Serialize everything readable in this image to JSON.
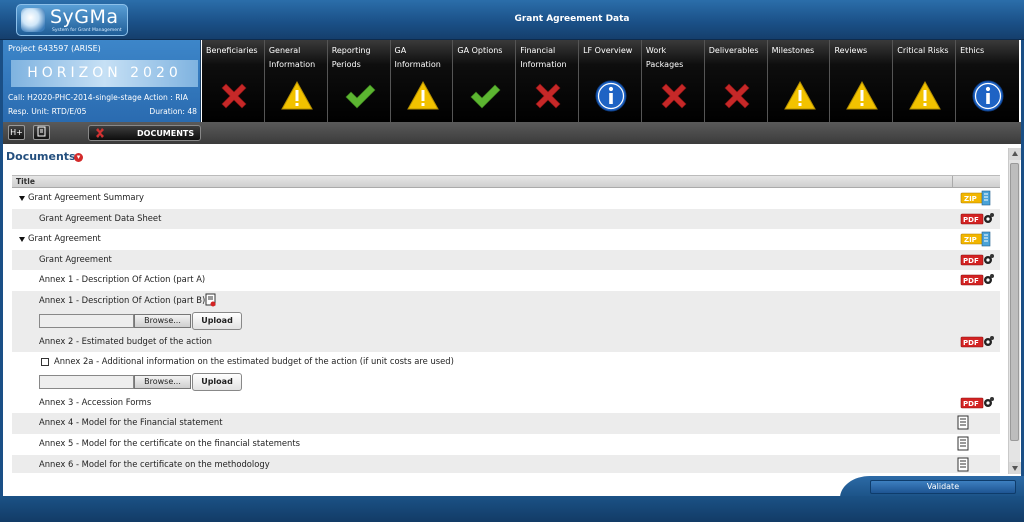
{
  "header": {
    "logo_text": "SyGMa",
    "logo_sub": "System for Grant Management",
    "title": "Grant Agreement Data"
  },
  "project": {
    "id": "Project 643597 (ARISE)",
    "programme": "HORIZON 2020",
    "call": "Call: H2020-PHC-2014-single-stage",
    "action": "Action : RIA",
    "unit": "Resp. Unit: RTD/E/05",
    "duration": "Duration: 48"
  },
  "tabs": [
    {
      "label": "Beneficiaries",
      "status": "error"
    },
    {
      "label": "General Information",
      "status": "warning"
    },
    {
      "label": "Reporting Periods",
      "status": "ok"
    },
    {
      "label": "GA Information",
      "status": "warning"
    },
    {
      "label": "GA Options",
      "status": "ok"
    },
    {
      "label": "Financial Information",
      "status": "error"
    },
    {
      "label": "LF Overview",
      "status": "info"
    },
    {
      "label": "Work Packages",
      "status": "error"
    },
    {
      "label": "Deliverables",
      "status": "error"
    },
    {
      "label": "Milestones",
      "status": "warning"
    },
    {
      "label": "Reviews",
      "status": "warning"
    },
    {
      "label": "Critical Risks",
      "status": "warning"
    },
    {
      "label": "Ethics",
      "status": "info"
    }
  ],
  "toolbar": {
    "btn1": "H+",
    "documents_label": "DOCUMENTS"
  },
  "documents": {
    "title": "Documents",
    "column_title": "Title",
    "rows": [
      {
        "text": "Grant Agreement Summary",
        "type": "group",
        "icon": "zip"
      },
      {
        "text": "Grant Agreement Data Sheet",
        "type": "child",
        "icon": "pdf"
      },
      {
        "text": "Grant Agreement",
        "type": "group",
        "icon": "zip"
      },
      {
        "text": "Grant Agreement",
        "type": "child",
        "icon": "pdf"
      },
      {
        "text": "Annex 1 - Description Of Action (part A)",
        "type": "child",
        "icon": "pdf"
      },
      {
        "text": "Annex 1 - Description Of Action (part B)",
        "type": "child",
        "icon": "none"
      },
      {
        "text": "Annex 2 - Estimated budget of the action",
        "type": "child",
        "icon": "pdf"
      },
      {
        "text": "Annex 2a - Additional information on the estimated budget of the action (if unit costs are used)",
        "type": "child",
        "icon": "none"
      },
      {
        "text": "Annex 3 - Accession Forms",
        "type": "child",
        "icon": "pdf"
      },
      {
        "text": "Annex 4 - Model for the Financial statement",
        "type": "child",
        "icon": "doc"
      },
      {
        "text": "Annex 5 - Model for the certificate on the financial statements",
        "type": "child",
        "icon": "doc"
      },
      {
        "text": "Annex 6 - Model for the certificate on the methodology",
        "type": "child",
        "icon": "doc"
      }
    ],
    "browse_label": "Browse...",
    "upload_label": "Upload"
  },
  "footer": {
    "validate_label": "Validate"
  },
  "colors": {
    "brand_blue": "#1a4f86",
    "error": "#c62828",
    "warning": "#f2c200",
    "ok": "#4caf2a",
    "info": "#1e63c4"
  }
}
